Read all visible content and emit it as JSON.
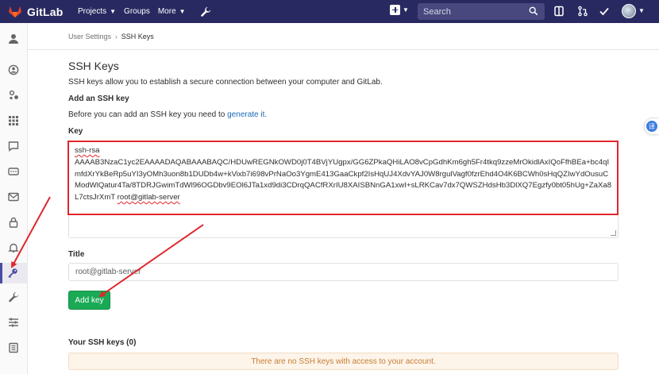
{
  "navbar": {
    "brand": "GitLab",
    "projects": "Projects",
    "groups": "Groups",
    "more": "More",
    "search_placeholder": "Search"
  },
  "sidebar": {
    "items": [
      "profile",
      "account",
      "applications",
      "chat",
      "access-tokens",
      "emails",
      "password",
      "notifications",
      "ssh-keys",
      "gpg-keys",
      "preferences",
      "authentication-log"
    ],
    "active": "ssh-keys"
  },
  "breadcrumb": {
    "parent": "User Settings",
    "current": "SSH Keys"
  },
  "page": {
    "title": "SSH Keys",
    "description": "SSH keys allow you to establish a secure connection between your computer and GitLab.",
    "add_title": "Add an SSH key",
    "before_text": "Before you can add an SSH key you need to ",
    "generate_link": "generate it.",
    "key_label": "Key",
    "key_type": "ssh-rsa",
    "key_body": "AAAAB3NzaC1yc2EAAAADAQABAAABAQC/HDUwREGNkOWD0j0T4BVjYUgpx/GG6ZPkaQHiLAO8vCpGdhKm6gh5Fr4tkq9zzeMrOkidlAxIQoFfhBEa+bc4qImfdXrYkBeRp5uYI3yOMh3uon8b1DUDb4w+kVixb7i698vPrNaOo3YgmE413GaaCkpf2IsHqUJ4XdvYAJ0W8rgulVagf0fzrEhd4O4K6BCWh0sHqQZIwYdOusuCModWlQatur4Ta/8TDRJGwimTdWl96OGDbv9EOl6JTa1xd9di3CDrqQACfRXrIU8XAISBNnGA1xwI+sLRKCav7dx7QWSZHdsHb3DlXQ7Egzfy0bt05hUg+ZaXa8L7ctsJrXmT",
    "key_comment": "root@gitlab-server",
    "title_label": "Title",
    "title_value": "root@gitlab-server",
    "add_button": "Add key",
    "your_keys": "Your SSH keys (0)",
    "no_keys": "There are no SSH keys with access to your account."
  },
  "floating_badge": "译",
  "colors": {
    "navbar": "#292961",
    "primary_button": "#1aaa55",
    "highlight_border": "#e0262d",
    "link": "#1b69b6",
    "warning_text": "#c77d34"
  }
}
